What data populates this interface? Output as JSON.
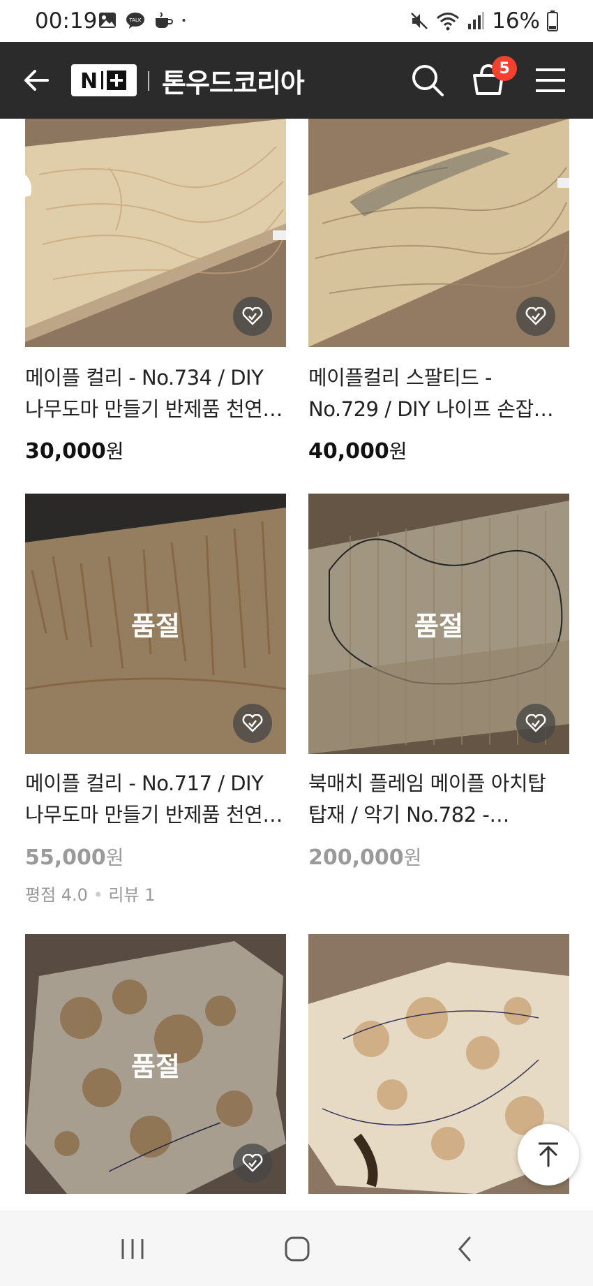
{
  "status_bar": {
    "time": "00:19",
    "battery": "16%",
    "icons": [
      "gallery-icon",
      "talk-icon",
      "coffee-icon",
      "dot-icon",
      "mute-icon",
      "wifi-icon",
      "signal-icon",
      "battery-icon"
    ]
  },
  "header": {
    "logo": "N+",
    "store_name": "톤우드코리아",
    "cart_count": "5",
    "icons": [
      "back-arrow-icon",
      "search-icon",
      "cart-icon",
      "hamburger-menu-icon"
    ]
  },
  "products": [
    {
      "title_line1": "메이플 컬리 - No.734 / DIY",
      "title_line2": "나무도마 만들기 반제품 천연…",
      "price": "30,000",
      "currency": "원",
      "sold_out": false
    },
    {
      "title_line1": "메이플컬리 스팔티드 -",
      "title_line2": "No.729 / DIY 나이프 손잡…",
      "price": "40,000",
      "currency": "원",
      "sold_out": false
    },
    {
      "title_line1": "메이플 컬리 - No.717 / DIY",
      "title_line2": "나무도마 만들기 반제품 천연…",
      "price": "55,000",
      "currency": "원",
      "sold_out": true,
      "sold_out_label": "품절",
      "rating": "평점 4.0",
      "reviews": "리뷰 1"
    },
    {
      "title_line1": "북매치 플레임 메이플 아치탑",
      "title_line2": "탑재 / 악기 No.782 -…",
      "price": "200,000",
      "currency": "원",
      "sold_out": true,
      "sold_out_label": "품절"
    },
    {
      "sold_out": true,
      "sold_out_label": "품절"
    },
    {
      "sold_out": false
    }
  ],
  "colors": {
    "header_bg": "#2b2b2b",
    "badge": "#f2412f",
    "sold_out_price": "#9a9a9a"
  }
}
